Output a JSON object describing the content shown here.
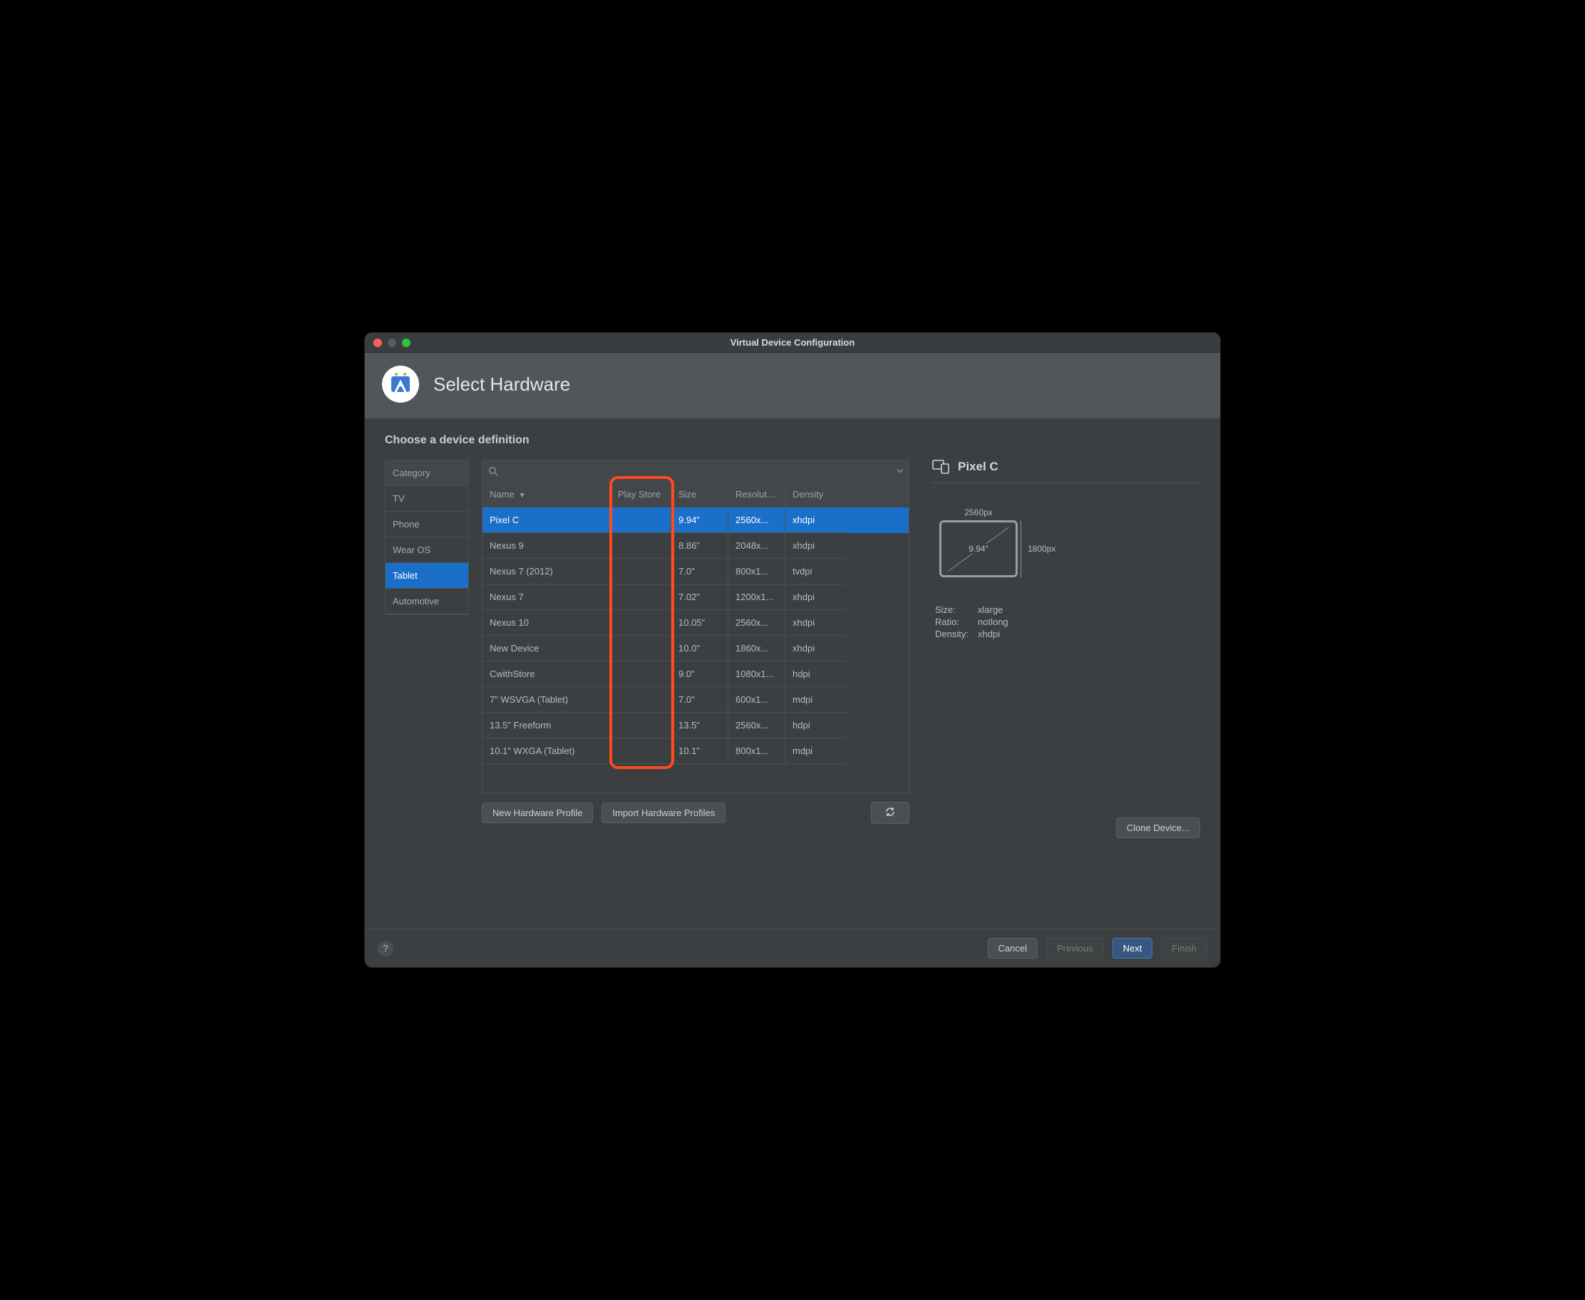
{
  "window": {
    "title": "Virtual Device Configuration"
  },
  "hero": {
    "title": "Select Hardware"
  },
  "section": {
    "title": "Choose a device definition"
  },
  "search": {
    "placeholder": ""
  },
  "categories": {
    "header": "Category",
    "items": [
      "TV",
      "Phone",
      "Wear OS",
      "Tablet",
      "Automotive"
    ],
    "selected_index": 3
  },
  "table": {
    "columns": [
      "Name",
      "Play Store",
      "Size",
      "Resolution",
      "Density"
    ],
    "sort_column": 0,
    "sort_dir": "desc",
    "selected_index": 0,
    "rows": [
      {
        "name": "Pixel C",
        "play_store": "",
        "size": "9.94\"",
        "resolution": "2560x...",
        "density": "xhdpi"
      },
      {
        "name": "Nexus 9",
        "play_store": "",
        "size": "8.86\"",
        "resolution": "2048x...",
        "density": "xhdpi"
      },
      {
        "name": "Nexus 7 (2012)",
        "play_store": "",
        "size": "7.0\"",
        "resolution": "800x1...",
        "density": "tvdpi"
      },
      {
        "name": "Nexus 7",
        "play_store": "",
        "size": "7.02\"",
        "resolution": "1200x1...",
        "density": "xhdpi"
      },
      {
        "name": "Nexus 10",
        "play_store": "",
        "size": "10.05\"",
        "resolution": "2560x...",
        "density": "xhdpi"
      },
      {
        "name": "New Device",
        "play_store": "",
        "size": "10.0\"",
        "resolution": "1860x...",
        "density": "xhdpi"
      },
      {
        "name": "CwithStore",
        "play_store": "",
        "size": "9.0\"",
        "resolution": "1080x1...",
        "density": "hdpi"
      },
      {
        "name": "7\" WSVGA (Tablet)",
        "play_store": "",
        "size": "7.0\"",
        "resolution": "600x1...",
        "density": "mdpi"
      },
      {
        "name": "13.5\" Freeform",
        "play_store": "",
        "size": "13.5\"",
        "resolution": "2560x...",
        "density": "hdpi"
      },
      {
        "name": "10.1\" WXGA (Tablet)",
        "play_store": "",
        "size": "10.1\"",
        "resolution": "800x1...",
        "density": "mdpi"
      }
    ]
  },
  "table_actions": {
    "new_profile": "New Hardware Profile",
    "import_profiles": "Import Hardware Profiles",
    "clone": "Clone Device..."
  },
  "preview": {
    "title": "Pixel C",
    "width_label": "2560px",
    "height_label": "1800px",
    "diagonal": "9.94\"",
    "specs": {
      "size_label": "Size:",
      "size_value": "xlarge",
      "ratio_label": "Ratio:",
      "ratio_value": "notlong",
      "density_label": "Density:",
      "density_value": "xhdpi"
    }
  },
  "footer": {
    "cancel": "Cancel",
    "previous": "Previous",
    "next": "Next",
    "finish": "Finish"
  }
}
